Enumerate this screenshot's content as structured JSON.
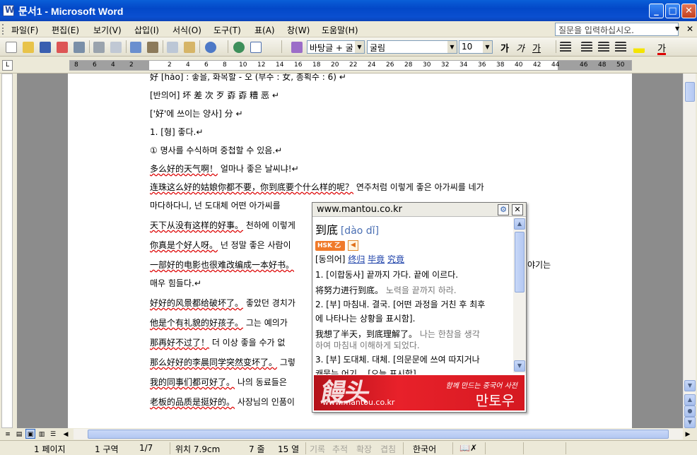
{
  "window": {
    "title": "문서1 - Microsoft Word"
  },
  "menu": {
    "items": [
      "파일(F)",
      "편집(E)",
      "보기(V)",
      "삽입(I)",
      "서식(O)",
      "도구(T)",
      "표(A)",
      "창(W)",
      "도움말(H)"
    ],
    "help_placeholder": "질문을 입력하십시오."
  },
  "toolbar": {
    "style": "바탕글 + 굴",
    "font": "굴림",
    "size": "10",
    "bold": "가",
    "italic": "가",
    "underline": "가",
    "font_color_glyph": "가"
  },
  "ruler": {
    "numbers": [
      "8",
      "6",
      "4",
      "2",
      "2",
      "4",
      "6",
      "8",
      "10",
      "12",
      "14",
      "16",
      "18",
      "20",
      "22",
      "24",
      "26",
      "28",
      "30",
      "32",
      "34",
      "36",
      "38",
      "40",
      "42",
      "44",
      "46",
      "48",
      "50"
    ],
    "corner": "L"
  },
  "document": {
    "lines": [
      {
        "cn": "",
        "kr": "好 [hǎo] : 좋을, 화목할 - 오 (부수 : 女, 총획수 : 6) ↵"
      },
      {
        "cn": "",
        "kr": "[반의어] 坏 差 次 歹 孬 孬 糟 恶 ↵"
      },
      {
        "cn": "",
        "kr": "['好'에 쓰이는 양사] 分 ↵"
      },
      {
        "cn": "",
        "kr": "1. [형] 좋다.↵"
      },
      {
        "cn": "",
        "kr": "① 명사를 수식하며 중첩할 수 있음.↵"
      },
      {
        "cn": "多么好的天气啊！",
        "kr": " 얼마나 좋은 날씨냐!↵"
      },
      {
        "cn": "连珠这么好的姑娘你都不要，你到底要个什么样的呢？",
        "kr": " 연주처럼 이렇게 좋은 아가씨를 네가"
      },
      {
        "cn": "",
        "kr": "마다하다니, 넌 도대체 어떤 아가씨를"
      },
      {
        "cn": "天下从没有这样的好事。",
        "kr": " 천하에 이렇게"
      },
      {
        "cn": "你真是个好人呀。",
        "kr": " 넌 정말 좋은 사람이"
      },
      {
        "cn": "一部好的电影也很难改编成一本好书。",
        "kr": ""
      },
      {
        "cn": "",
        "kr": "매우 힘들다.↵"
      },
      {
        "cn": "好好的风景都给破坏了。",
        "kr": " 좋았던 경치가"
      },
      {
        "cn": "他是个有礼貌的好孩子。",
        "kr": " 그는 예의가"
      },
      {
        "cn": "那再好不过了！",
        "kr": " 더 이상 좋을 수가 없"
      },
      {
        "cn": "那么好好的李晨同学突然变坏了。",
        "kr": " 그렇"
      },
      {
        "cn": "我的同事们都可好了。",
        "kr": " 나의 동료들은"
      },
      {
        "cn": "老板的品质是挺好的。",
        "kr": " 사장님의 인품이"
      }
    ],
    "right_fragment": "야기는"
  },
  "popup": {
    "url": "www.mantou.co.kr",
    "headword": "到底",
    "pinyin": "[dào dǐ]",
    "hsk": "HSK 乙",
    "synonym_label": "[동의어]",
    "synonyms": [
      "终归",
      "毕竟",
      "究竟"
    ],
    "lines": [
      "1. [이합동사] 끝까지 가다. 끝에 이르다.",
      "2. [부] 마침내. 결국. [어떤 과정을 거친 후 최후",
      "에 나타나는 상황을 표시함].",
      "3. [부] 도대체. 대체. [의문문에 쓰여 따지거나"
    ],
    "ex1_cn": "将努力进行到底。",
    "ex1_kr": "노력을 끝까지 하라.",
    "ex2_cn": "我想了半天，到底理解了。",
    "ex2_kr": "나는 한참을 생각",
    "ex2_kr2": "하여 마침내 이해하게 되었다.",
    "cut_line": "캐묻는 어기... [오늘 표시함]",
    "banner_logo": "饅头",
    "banner_tag": "함께 만드는 중국어 사전",
    "banner_name": "만토우",
    "banner_url": "www.mantou.co.kr"
  },
  "status": {
    "page": "1 페이지",
    "section": "1 구역",
    "pages": "1/7",
    "pos": "위치 7.9cm",
    "line": "7 줄",
    "col": "15 열",
    "rec": "기록",
    "trk": "추적",
    "ext": "확장",
    "ovr": "겹침",
    "lang": "한국어"
  },
  "colors": {
    "titlebar": "#0348c8",
    "spell_underline": "#dd0000",
    "banner": "#d51921"
  }
}
